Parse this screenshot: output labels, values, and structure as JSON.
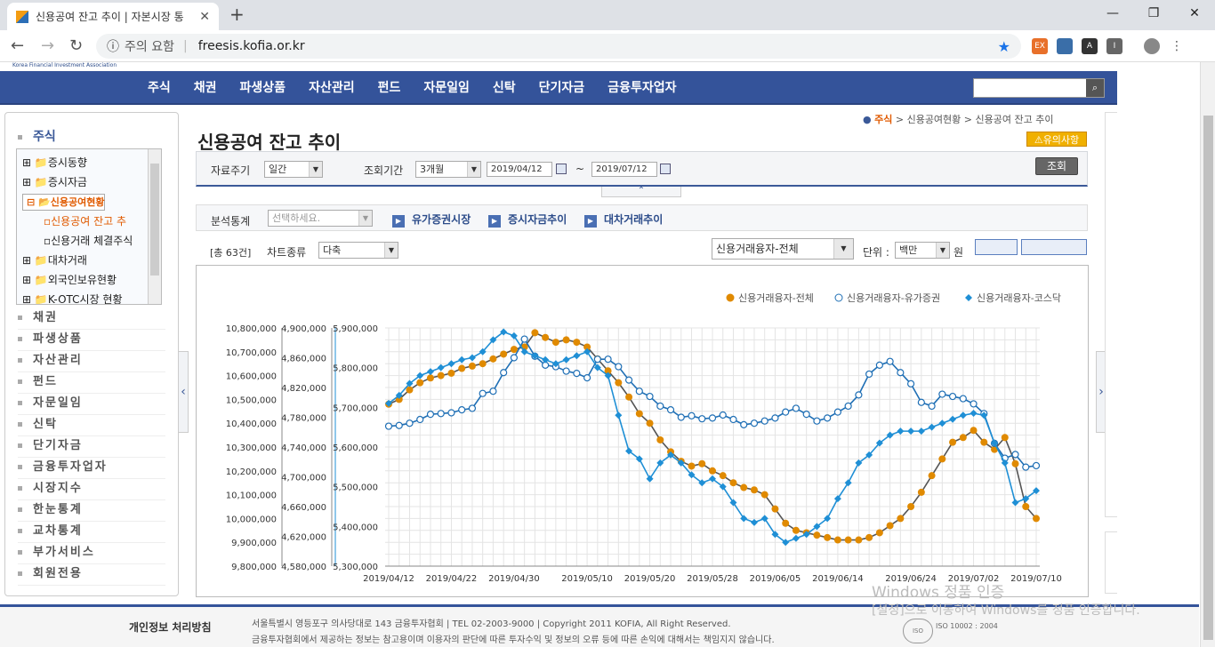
{
  "browser": {
    "tab_title": "신용공여 잔고 추이 | 자본시장 통",
    "security": "주의 요함",
    "url": "freesis.kofia.or.kr"
  },
  "site": {
    "logo_text": "Korea Financial Investment Association",
    "gnb": [
      "주식",
      "채권",
      "파생상품",
      "자산관리",
      "펀드",
      "자문일임",
      "신탁",
      "단기자금",
      "금융투자업자"
    ]
  },
  "lnb": {
    "title": "주식",
    "tree": [
      {
        "label": "증시동향",
        "type": "folder"
      },
      {
        "label": "증시자금",
        "type": "folder"
      },
      {
        "label": "신용공여현황",
        "type": "open"
      },
      {
        "label": "신용공여 잔고 추",
        "type": "sub-current"
      },
      {
        "label": "신용거래 체결주식",
        "type": "sub"
      },
      {
        "label": "대차거래",
        "type": "folder"
      },
      {
        "label": "외국인보유현황",
        "type": "folder"
      },
      {
        "label": "K-OTC시장 현황",
        "type": "folder"
      }
    ],
    "items": [
      "채권",
      "파생상품",
      "자산관리",
      "펀드",
      "자문일임",
      "신탁",
      "단기자금",
      "금융투자업자",
      "시장지수",
      "한눈통계",
      "교차통계",
      "부가서비스",
      "회원전용"
    ]
  },
  "breadcrumb": {
    "root": "주식",
    "mid": "> 신용공여현황",
    "cur": "> 신용공여 잔고 추이"
  },
  "page": {
    "title": "신용공여 잔고 추이",
    "notice": "유의사항"
  },
  "filter": {
    "period_label": "자료주기",
    "period_value": "일간",
    "range_label": "조회기간",
    "range_value": "3개월",
    "start": "2019/04/12",
    "tilde": "~",
    "end": "2019/07/12",
    "search": "조회"
  },
  "analysis": {
    "label": "분석통계",
    "select": "선택하세요.",
    "links": [
      "유가증권시장",
      "증시자금추이",
      "대차거래추이"
    ]
  },
  "controls": {
    "count": "[총 63건]",
    "chart_type_label": "차트종류",
    "chart_type_value": "다축",
    "series_select": "신용거래융자-전체",
    "unit_label": "단위 :",
    "unit_value": "백만",
    "unit_suffix": "원"
  },
  "chart_data": {
    "type": "line",
    "x_labels": [
      "2019/04/12",
      "2019/04/22",
      "2019/04/30",
      "2019/05/10",
      "2019/05/20",
      "2019/05/28",
      "2019/06/05",
      "2019/06/14",
      "2019/06/24",
      "2019/07/02",
      "2019/07/10"
    ],
    "axes": [
      {
        "ticks": [
          "10,800,000",
          "10,700,000",
          "10,600,000",
          "10,500,000",
          "10,400,000",
          "10,300,000",
          "10,200,000",
          "10,100,000",
          "10,000,000",
          "9,900,000",
          "9,800,000"
        ],
        "min": 9800000,
        "max": 10800000
      },
      {
        "ticks": [
          "4,900,000",
          "4,860,000",
          "4,820,000",
          "4,780,000",
          "4,740,000",
          "4,700,000",
          "4,660,000",
          "4,620,000",
          "4,580,000"
        ],
        "min": 4580000,
        "max": 4900000
      },
      {
        "ticks": [
          "5,900,000",
          "5,800,000",
          "5,700,000",
          "5,600,000",
          "5,500,000",
          "5,400,000",
          "5,300,000"
        ],
        "min": 5300000,
        "max": 5900000
      }
    ],
    "series": [
      {
        "name": "신용거래융자-전체",
        "color": "#e08a00",
        "axis": 0,
        "values": [
          10480000,
          10500000,
          10540000,
          10570000,
          10590000,
          10600000,
          10610000,
          10630000,
          10640000,
          10650000,
          10670000,
          10690000,
          10710000,
          10720000,
          10780000,
          10760000,
          10740000,
          10750000,
          10740000,
          10720000,
          10670000,
          10620000,
          10570000,
          10510000,
          10440000,
          10400000,
          10330000,
          10280000,
          10240000,
          10220000,
          10230000,
          10200000,
          10180000,
          10150000,
          10130000,
          10120000,
          10100000,
          10040000,
          9980000,
          9950000,
          9940000,
          9930000,
          9920000,
          9910000,
          9910000,
          9910000,
          9920000,
          9940000,
          9970000,
          10000000,
          10050000,
          10110000,
          10180000,
          10250000,
          10320000,
          10340000,
          10370000,
          10320000,
          10290000,
          10340000,
          10230000,
          10050000,
          10000000
        ]
      },
      {
        "name": "신용거래융자-유가증권",
        "color": "#1f6fb5",
        "axis": 1,
        "hollow": true,
        "values": [
          4768000,
          4769000,
          4772000,
          4777000,
          4784000,
          4785000,
          4786000,
          4790000,
          4792000,
          4812000,
          4815000,
          4840000,
          4860000,
          4885000,
          4862000,
          4850000,
          4848000,
          4842000,
          4839000,
          4833000,
          4858000,
          4858000,
          4848000,
          4830000,
          4815000,
          4808000,
          4795000,
          4790000,
          4780000,
          4782000,
          4778000,
          4779000,
          4783000,
          4777000,
          4770000,
          4772000,
          4775000,
          4779000,
          4787000,
          4792000,
          4784000,
          4775000,
          4779000,
          4787000,
          4795000,
          4810000,
          4838000,
          4850000,
          4855000,
          4840000,
          4825000,
          4800000,
          4795000,
          4811000,
          4808000,
          4805000,
          4798000,
          4785000,
          4745000,
          4725000,
          4730000,
          4713000,
          4715000
        ]
      },
      {
        "name": "신용거래융자-코스닥",
        "color": "#1f8fd5",
        "axis": 2,
        "diamond": true,
        "values": [
          5710000,
          5730000,
          5760000,
          5780000,
          5790000,
          5800000,
          5810000,
          5820000,
          5825000,
          5840000,
          5870000,
          5890000,
          5880000,
          5840000,
          5830000,
          5820000,
          5810000,
          5820000,
          5830000,
          5840000,
          5800000,
          5780000,
          5680000,
          5590000,
          5570000,
          5520000,
          5560000,
          5580000,
          5560000,
          5530000,
          5510000,
          5520000,
          5500000,
          5460000,
          5420000,
          5410000,
          5420000,
          5380000,
          5360000,
          5370000,
          5380000,
          5400000,
          5420000,
          5470000,
          5510000,
          5560000,
          5580000,
          5610000,
          5630000,
          5640000,
          5640000,
          5640000,
          5650000,
          5660000,
          5670000,
          5680000,
          5685000,
          5680000,
          5610000,
          5560000,
          5460000,
          5470000,
          5490000
        ]
      }
    ]
  },
  "footer": {
    "policy": "개인정보 처리방침",
    "line1": "서울특별시 영등포구 의사당대로 143 금융투자협회   |  TEL 02-2003-9000  |  Copyright 2011 KOFIA, All Right Reserved.",
    "line2": "금융투자협회에서 제공하는 정보는 참고용이며 이용자의 판단에 따른 투자수익 및 정보의 오류 등에 따른 손익에 대해서는 책임지지 않습니다.",
    "iso": "ISO 10002 : 2004"
  },
  "watermark": {
    "l1": "Windows 정품 인증",
    "l2": "[설정]으로 이동하여 Windows를 정품 인증합니다."
  }
}
